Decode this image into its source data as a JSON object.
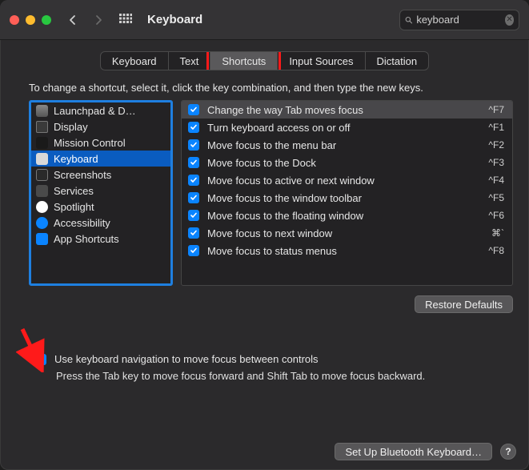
{
  "header": {
    "title": "Keyboard",
    "search_value": "keyboard"
  },
  "tabs": [
    "Keyboard",
    "Text",
    "Shortcuts",
    "Input Sources",
    "Dictation"
  ],
  "active_tab_index": 2,
  "instruction": "To change a shortcut, select it, click the key combination, and then type the new keys.",
  "categories": [
    {
      "icon": "launchpad-icon",
      "label": "Launchpad & D…"
    },
    {
      "icon": "display-icon",
      "label": "Display"
    },
    {
      "icon": "mission-control-icon",
      "label": "Mission Control"
    },
    {
      "icon": "keyboard-icon",
      "label": "Keyboard",
      "selected": true
    },
    {
      "icon": "screenshots-icon",
      "label": "Screenshots"
    },
    {
      "icon": "services-icon",
      "label": "Services"
    },
    {
      "icon": "spotlight-icon",
      "label": "Spotlight"
    },
    {
      "icon": "accessibility-icon",
      "label": "Accessibility"
    },
    {
      "icon": "app-shortcuts-icon",
      "label": "App Shortcuts"
    }
  ],
  "shortcuts": [
    {
      "checked": true,
      "label": "Change the way Tab moves focus",
      "key": "^F7",
      "selected": true
    },
    {
      "checked": true,
      "label": "Turn keyboard access on or off",
      "key": "^F1"
    },
    {
      "checked": true,
      "label": "Move focus to the menu bar",
      "key": "^F2"
    },
    {
      "checked": true,
      "label": "Move focus to the Dock",
      "key": "^F3"
    },
    {
      "checked": true,
      "label": "Move focus to active or next window",
      "key": "^F4"
    },
    {
      "checked": true,
      "label": "Move focus to the window toolbar",
      "key": "^F5"
    },
    {
      "checked": true,
      "label": "Move focus to the floating window",
      "key": "^F6"
    },
    {
      "checked": true,
      "label": "Move focus to next window",
      "key": "⌘`"
    },
    {
      "checked": true,
      "label": "Move focus to status menus",
      "key": "^F8"
    }
  ],
  "restore_label": "Restore Defaults",
  "keyboard_nav": {
    "checked": true,
    "label": "Use keyboard navigation to move focus between controls",
    "hint": "Press the Tab key to move focus forward and Shift Tab to move focus backward."
  },
  "footer": {
    "bluetooth_label": "Set Up Bluetooth Keyboard…",
    "help_label": "?"
  }
}
